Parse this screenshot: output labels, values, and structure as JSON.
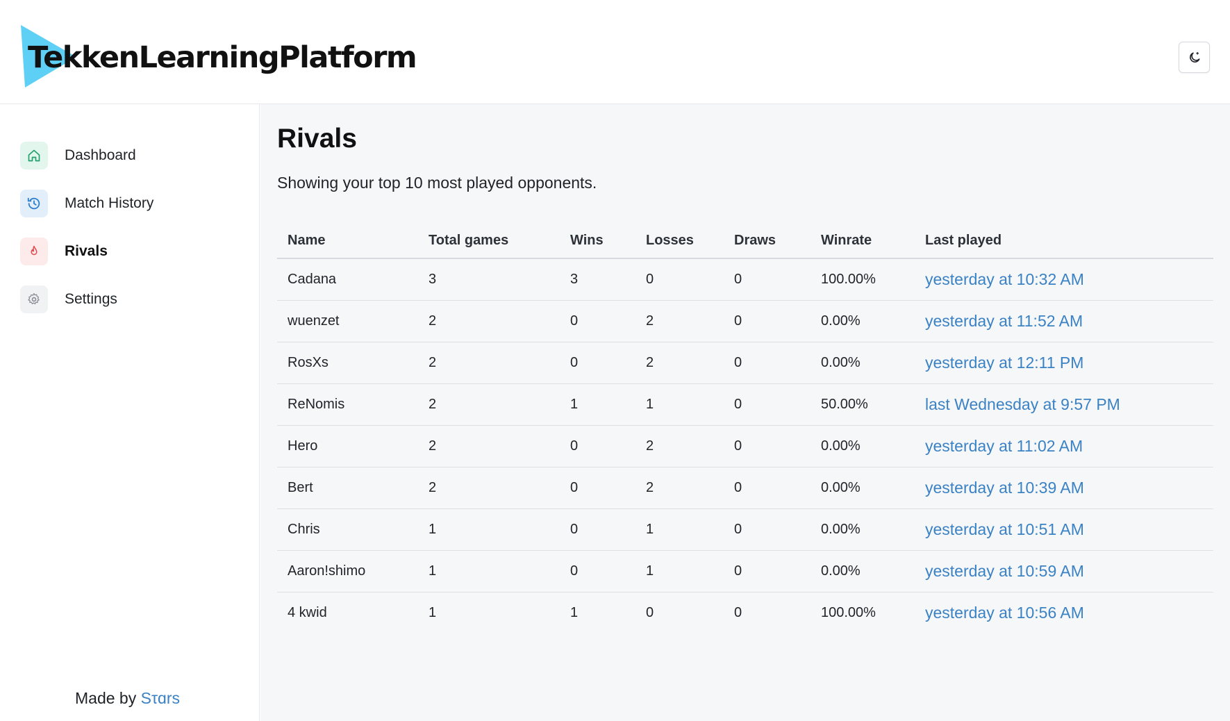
{
  "app": {
    "title": "TekkenLearningPlatform"
  },
  "theme_toggle": {
    "icon": "moon-icon"
  },
  "sidebar": {
    "items": [
      {
        "label": "Dashboard",
        "icon": "home-icon",
        "active": false
      },
      {
        "label": "Match History",
        "icon": "history-icon",
        "active": false
      },
      {
        "label": "Rivals",
        "icon": "flame-icon",
        "active": true
      },
      {
        "label": "Settings",
        "icon": "gear-icon",
        "active": false
      }
    ],
    "footer": {
      "prefix": "Made by",
      "author": "Sτɑrs"
    }
  },
  "main": {
    "title": "Rivals",
    "subtitle": "Showing your top 10 most played opponents.",
    "table": {
      "headers": [
        "Name",
        "Total games",
        "Wins",
        "Losses",
        "Draws",
        "Winrate",
        "Last played"
      ],
      "rows": [
        [
          "Cadana",
          "3",
          "3",
          "0",
          "0",
          "100.00%",
          "yesterday at 10:32 AM"
        ],
        [
          "wuenzet",
          "2",
          "0",
          "2",
          "0",
          "0.00%",
          "yesterday at 11:52 AM"
        ],
        [
          "RosXs",
          "2",
          "0",
          "2",
          "0",
          "0.00%",
          "yesterday at 12:11 PM"
        ],
        [
          "ReNomis",
          "2",
          "1",
          "1",
          "0",
          "50.00%",
          "last Wednesday at 9:57 PM"
        ],
        [
          "Hero",
          "2",
          "0",
          "2",
          "0",
          "0.00%",
          "yesterday at 11:02 AM"
        ],
        [
          "Bert",
          "2",
          "0",
          "2",
          "0",
          "0.00%",
          "yesterday at 10:39 AM"
        ],
        [
          "Chris",
          "1",
          "0",
          "1",
          "0",
          "0.00%",
          "yesterday at 10:51 AM"
        ],
        [
          "Aaron!shimo",
          "1",
          "0",
          "1",
          "0",
          "0.00%",
          "yesterday at 10:59 AM"
        ],
        [
          "4 kwid",
          "1",
          "1",
          "0",
          "0",
          "100.00%",
          "yesterday at 10:56 AM"
        ]
      ]
    }
  },
  "colors": {
    "accent_link": "#3b82c4",
    "logo_triangle": "#5fd0f5",
    "dashboard_icon": "#22a06b",
    "history_icon": "#2f7fd0",
    "rivals_icon": "#e5484d",
    "settings_icon": "#8b9098"
  }
}
